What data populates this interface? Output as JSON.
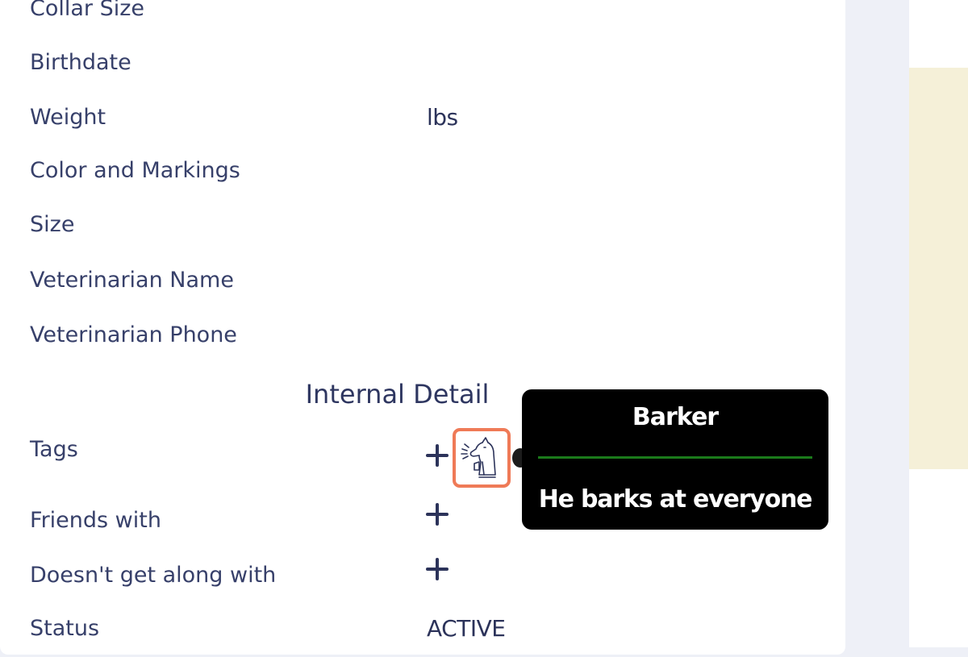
{
  "fields": [
    {
      "label": "Collar Size",
      "value": ""
    },
    {
      "label": "Birthdate",
      "value": ""
    },
    {
      "label": "Weight",
      "value": "lbs"
    },
    {
      "label": "Color and Markings",
      "value": ""
    },
    {
      "label": "Size",
      "value": ""
    },
    {
      "label": "Veterinarian Name",
      "value": ""
    },
    {
      "label": "Veterinarian Phone",
      "value": ""
    }
  ],
  "internal": {
    "title": "Internal Detail",
    "tags_label": "Tags",
    "friends_label": "Friends with",
    "not_along_label": "Doesn't get along with",
    "status_label": "Status",
    "status_value": "ACTIVE"
  },
  "tag": {
    "icon": "barking-dog-icon"
  },
  "tooltip": {
    "title": "Barker",
    "body": "He barks at everyone"
  },
  "colors": {
    "highlight": "#ef7a57",
    "tooltip_bg": "#000000",
    "tooltip_rule": "#1b7a1b",
    "text": "#37406a",
    "right_card_accent": "#f5f0d8"
  }
}
